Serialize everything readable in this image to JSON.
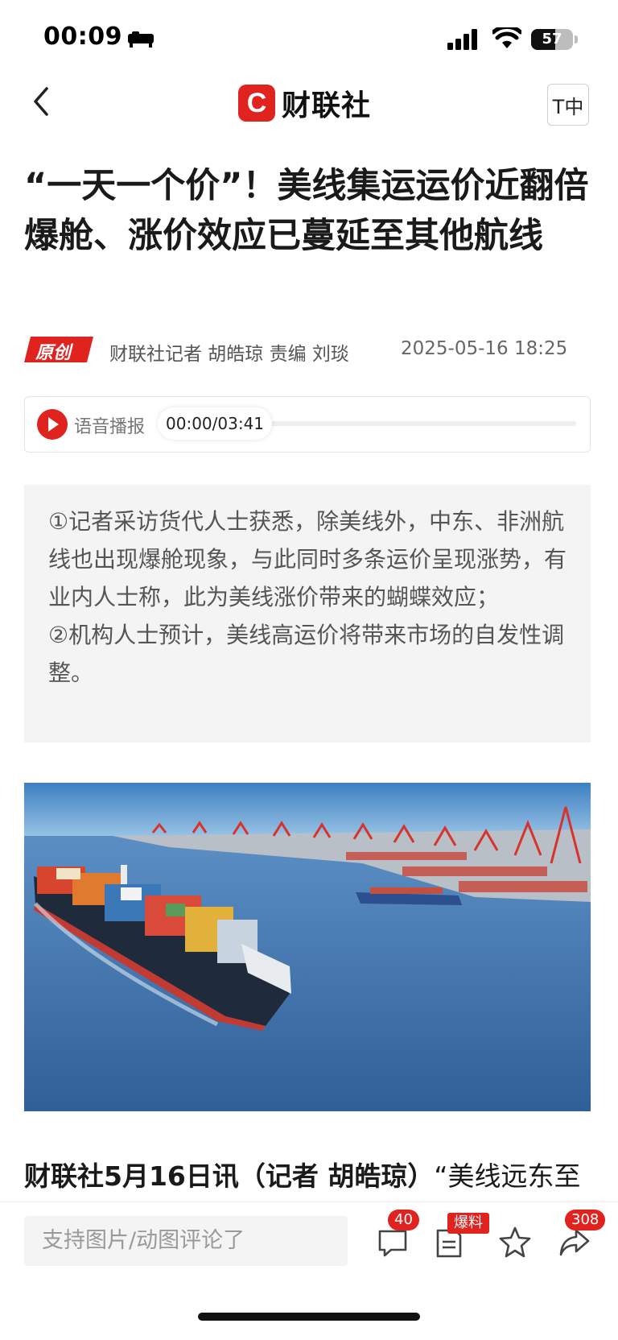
{
  "status_bar": {
    "time": "00:09",
    "battery": "57",
    "battery_level": 0.57
  },
  "nav": {
    "brand_mark": "C",
    "brand_name": "财联社",
    "font_size_button": "T中"
  },
  "article": {
    "title": "“一天一个价”！美线集运运价近翻倍 爆舱、涨价效应已蔓延至其他航线",
    "badge": "原创",
    "author": "财联社记者 胡皓琼  责编 刘琰",
    "date": "2025-05-16 18:25",
    "audio": {
      "label": "语音播报",
      "time": "00:00/03:41",
      "progress": 0
    },
    "summary": [
      "①记者采访货代人士获悉，除美线外，中东、非洲航线也出现爆舱现象，与此同时多条运价呈现涨势，有业内人士称，此为美线涨价带来的蝴蝶效应；",
      "②机构人士预计，美线高运价将带来市场的自发性调整。"
    ],
    "lead_bold": "财联社5月16日讯（记者 胡皓琼）",
    "lead_rest": "“美线远东至"
  },
  "bottom_bar": {
    "comment_placeholder": "支持图片/动图评论了",
    "comment_count": "40",
    "tip_label": "爆料",
    "share_count": "308"
  },
  "colors": {
    "accent": "#e0231f"
  }
}
